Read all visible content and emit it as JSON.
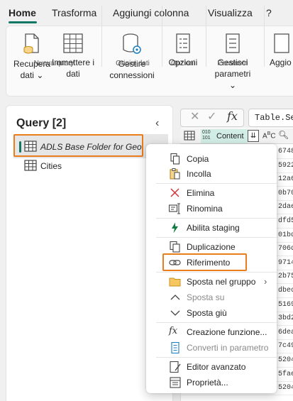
{
  "tabs": [
    "Home",
    "Trasforma",
    "Aggiungi colonna",
    "Visualizza",
    "?"
  ],
  "ribbon": {
    "recupera": "Recupera",
    "recupera2": "dati",
    "immettere": "Immettere i",
    "immettere2": "dati",
    "gestire": "Gestire",
    "gestire2": "connessioni",
    "opzioni": "Opzioni",
    "gestisci": "Gestisci",
    "gestisci2": "parametri",
    "aggiorna": "Aggio",
    "groups": [
      "Nuova query",
      "Origini dati",
      "Opzioni",
      "Parametri"
    ]
  },
  "query_pane": {
    "title": "Query [2]",
    "items": [
      "ADLS Base Folder for Geo",
      "Cities"
    ]
  },
  "formula_bar": {
    "fx": "fx",
    "formula": "Table.Sel"
  },
  "grid": {
    "column_type": "010\n101",
    "column_name": "Content",
    "cells": [
      "6748",
      "5922",
      "12a6",
      "0b70",
      "2dae",
      "dfd5",
      "01bd",
      "706d",
      "9714",
      "2b75",
      "dbec",
      "5169",
      "3bd2",
      "6dea",
      "7c49",
      "5204",
      "5fae",
      "5204"
    ]
  },
  "context_menu": {
    "items": [
      "Copia",
      "Incolla",
      "Elimina",
      "Rinomina",
      "Abilita staging",
      "Duplicazione",
      "Riferimento",
      "Sposta nel gruppo",
      "Sposta su",
      "Sposta giù",
      "Creazione funzione...",
      "Converti in parametro",
      "Editor avanzato",
      "Proprietà..."
    ]
  },
  "colors": {
    "accent": "#117865",
    "highlight": "#e97d1c"
  }
}
